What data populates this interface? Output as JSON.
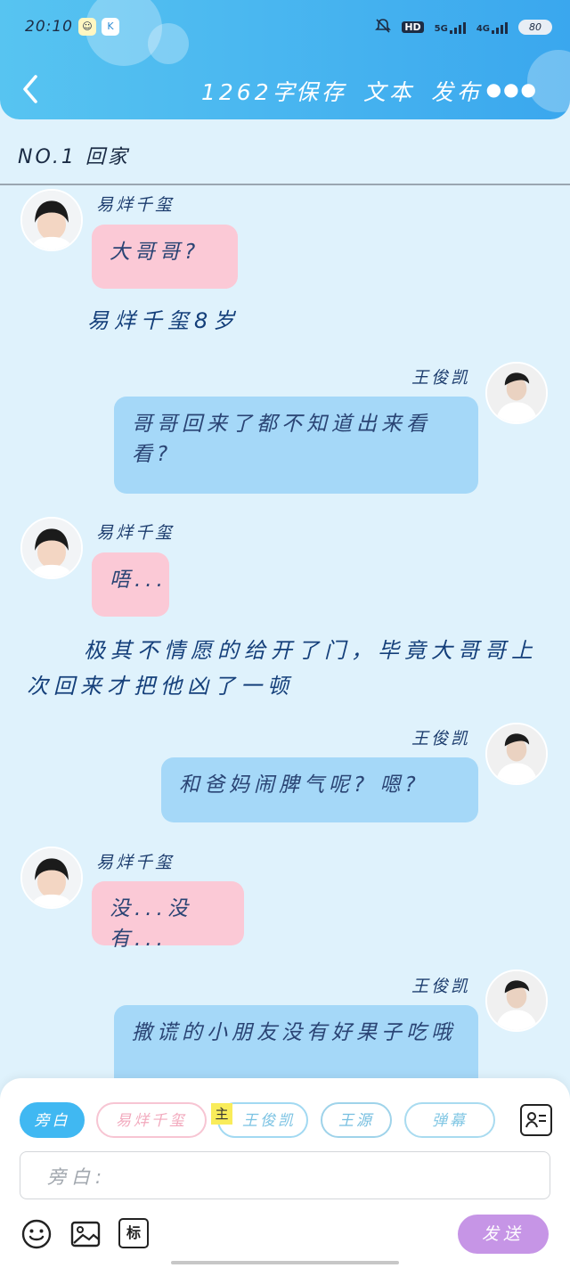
{
  "status_bar": {
    "time": "20:10",
    "icons": [
      "app-icon-1",
      "app-icon-2",
      "mute-bell-icon",
      "hd-icon",
      "5g-signal-icon",
      "4g-signal-icon",
      "battery-icon"
    ],
    "hd": "HD",
    "net1": "5G",
    "net2": "4G",
    "battery": "80"
  },
  "toolbar": {
    "word_count": "1262字",
    "save": "保存",
    "text": "文本",
    "publish": "发布"
  },
  "chapter": {
    "title": "NO.1 回家"
  },
  "messages": [
    {
      "type": "left",
      "name": "易烊千玺",
      "text": "大哥哥?"
    },
    {
      "type": "narration",
      "text": "易烊千玺8岁"
    },
    {
      "type": "right",
      "name": "王俊凯",
      "text": "哥哥回来了都不知道出来看看?"
    },
    {
      "type": "left",
      "name": "易烊千玺",
      "text": "唔..."
    },
    {
      "type": "narration",
      "text": "极其不情愿的给开了门，毕竟大哥哥上次回来才把他凶了一顿"
    },
    {
      "type": "right",
      "name": "王俊凯",
      "text": "和爸妈闹脾气呢? 嗯?"
    },
    {
      "type": "left",
      "name": "易烊千玺",
      "text": "没...没有..."
    },
    {
      "type": "right",
      "name": "王俊凯",
      "text": "撒谎的小朋友没有好果子吃哦"
    }
  ],
  "roles": [
    {
      "label": "旁白",
      "color": "#40b8f2",
      "selected": true
    },
    {
      "label": "易烊千玺",
      "color": "#f7c5d3",
      "selected": false
    },
    {
      "label": "王俊凯",
      "color": "#a2d9f2",
      "selected": false
    },
    {
      "label": "王源",
      "color": "#9fd3ea",
      "selected": false
    },
    {
      "label": "弹幕",
      "color": "#a9dbf0",
      "selected": false
    }
  ],
  "main_badge": "主",
  "input": {
    "placeholder": "旁白:"
  },
  "tools": {
    "mark_label": "标"
  },
  "send_label": "发送",
  "colors": {
    "header": "#49b6f0",
    "background": "#dff2fc",
    "pink_bubble": "#fbc9d6",
    "blue_bubble": "#a5d8f8",
    "send": "#c695e6"
  }
}
